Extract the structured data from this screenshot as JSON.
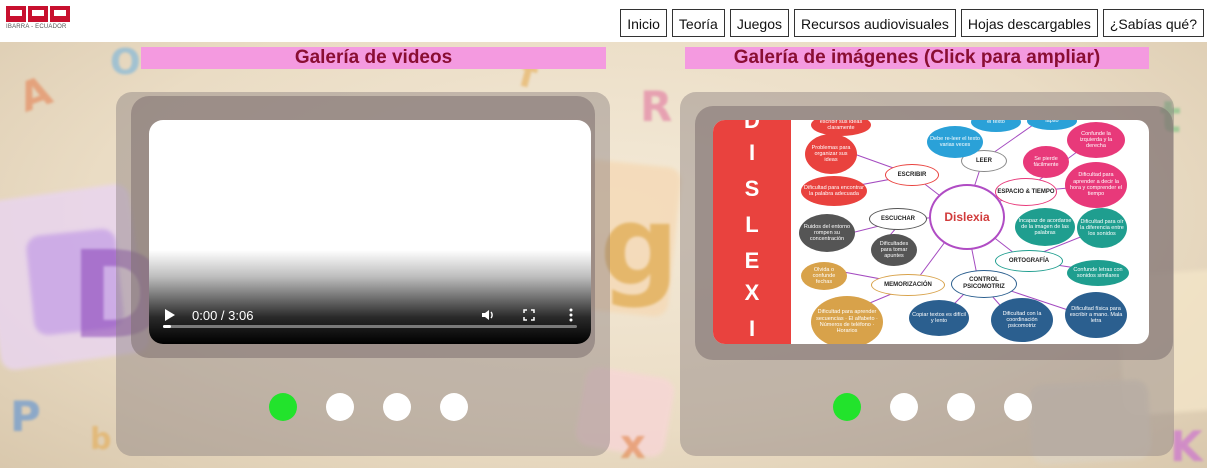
{
  "header": {
    "logo": {
      "text": "UTN",
      "subtitle": "IBARRA - ECUADOR",
      "color": "#c8102e"
    },
    "nav": [
      "Inicio",
      "Teoría",
      "Juegos",
      "Recursos audiovisuales",
      "Hojas descargables",
      "¿Sabías qué?"
    ]
  },
  "video_gallery": {
    "title": "Galería de videos",
    "player": {
      "time": "0:00 / 3:06",
      "progress": 0.02
    },
    "dots": {
      "count": 4,
      "active": 0
    }
  },
  "image_gallery": {
    "title": "Galería de imágenes (Click para ampliar)",
    "mindmap": {
      "side_letters": [
        "D",
        "I",
        "S",
        "L",
        "E",
        "X",
        "I"
      ],
      "center": "Dislexia",
      "nodes": {
        "escribir": "ESCRIBIR",
        "leer": "LEER",
        "espacio": "ESPACIO & TIEMPO",
        "escuchar": "ESCUCHAR",
        "ortografia": "ORTOGRAFÍA",
        "memorizacion": "MEMORIZACIÓN",
        "control": "CONTROL PSICOMOTRIZ"
      },
      "bubbles": {
        "b1": "escribir sus ideas claramente",
        "b2": "Problemas para organizar sus ideas",
        "b3": "Dificultad para encontrar la palabra adecuada",
        "b4": "Debe re-leer el texto varias veces",
        "b5": "el texto",
        "b6": "lapso",
        "b7": "Confunde la izquierda y la derecha",
        "b8": "Se pierde fácilmente",
        "b9": "Dificultad para aprender a decir la hora y comprender el tiempo",
        "b10": "Ruidos del entorno rompen su concentración",
        "b11": "Dificultades para tomar apuntes",
        "b12": "Incapaz de acordarse de la imagen de las palabras",
        "b13": "Dificultad para oír la diferencia entre los sonidos",
        "b14": "Confunde letras con sonidos similares",
        "b15": "Olvida o confunde fechas",
        "b16": "Dificultad para aprender secuencias · El alfabeto · Números de teléfono · Horarios",
        "b17": "Copiar textos es difícil y lento",
        "b18": "Dificultad con la coordinación psicomotriz",
        "b19": "Dificultad física para escribir a mano. Mala letra"
      }
    },
    "dots": {
      "count": 4,
      "active": 0
    }
  },
  "colors": {
    "title_bg": "#f49ae0",
    "title_text": "#8a0e33",
    "dot_active": "#22e32c",
    "dot_inactive": "#ffffff",
    "mindmap_red": "#e9423e",
    "mindmap_pink": "#e8397a",
    "mindmap_teal": "#1f9e8f",
    "mindmap_navy": "#2b5f8f",
    "mindmap_gray": "#555555",
    "mindmap_gold": "#d8a24a"
  }
}
